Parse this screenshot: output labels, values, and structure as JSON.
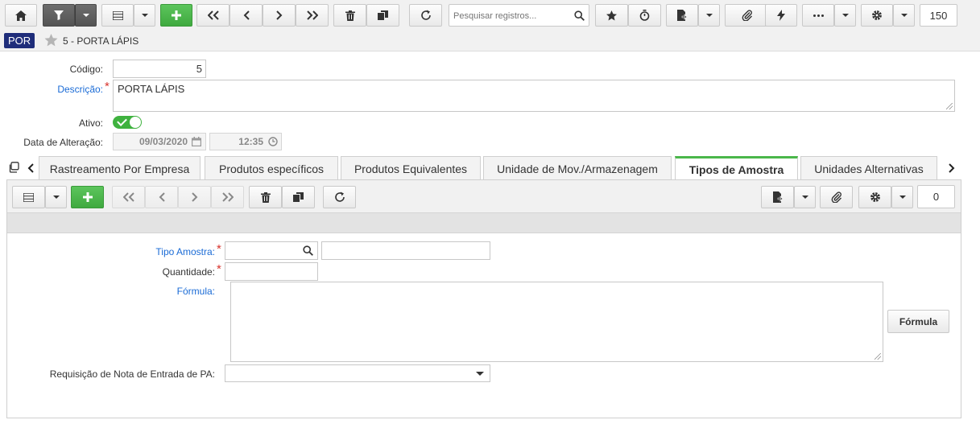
{
  "toolbar": {
    "search_placeholder": "Pesquisar registros...",
    "record_count": "150"
  },
  "record": {
    "badge": "POR",
    "title": "5 - PORTA LÁPIS"
  },
  "form": {
    "codigo_label": "Código:",
    "codigo_value": "5",
    "descricao_label": "Descrição:",
    "descricao_value": "PORTA LÁPIS",
    "ativo_label": "Ativo:",
    "ativo_value": true,
    "data_label": "Data de Alteração:",
    "data_value": "09/03/2020",
    "hora_value": "12:35"
  },
  "tabs": [
    {
      "label": "Rastreamento Por Empresa"
    },
    {
      "label": "Produtos específicos"
    },
    {
      "label": "Produtos Equivalentes"
    },
    {
      "label": "Unidade de Mov./Armazenagem"
    },
    {
      "label": "Tipos de Amostra"
    },
    {
      "label": "Unidades Alternativas"
    }
  ],
  "active_tab": "Tipos de Amostra",
  "sub": {
    "record_count": "0",
    "tipo_amostra_label": "Tipo Amostra:",
    "quantidade_label": "Quantidade:",
    "formula_label": "Fórmula:",
    "formula_button": "Fórmula",
    "requisicao_label": "Requisição de Nota de Entrada de PA:"
  },
  "colors": {
    "accent_green": "#4ab74a",
    "badge_blue": "#1f2d7a",
    "link_blue": "#1a6bd6",
    "required_red": "#d8342e"
  },
  "icons": [
    "home-icon",
    "filter-icon",
    "list-icon",
    "plus-icon",
    "first-icon",
    "prev-icon",
    "next-icon",
    "last-icon",
    "trash-icon",
    "copy-icon",
    "refresh-icon",
    "search-icon",
    "star-icon",
    "timer-icon",
    "report-icon",
    "paperclip-icon",
    "bolt-icon",
    "more-icon",
    "gear-icon",
    "calendar-icon",
    "clock-icon"
  ]
}
